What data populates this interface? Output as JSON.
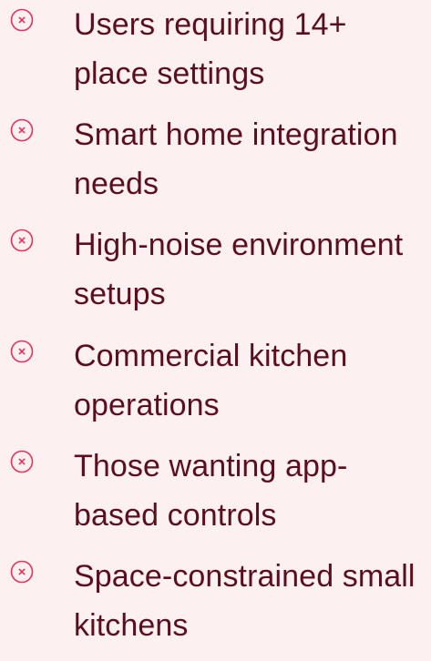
{
  "colors": {
    "background": "#fdf0f1",
    "text": "#5b0f1e",
    "icon": "#ec2f5b"
  },
  "limitations": {
    "items": [
      {
        "icon": "x-circle-icon",
        "text": "Users requiring 14+ place settings"
      },
      {
        "icon": "x-circle-icon",
        "text": "Smart home integration needs"
      },
      {
        "icon": "x-circle-icon",
        "text": "High-noise environment setups"
      },
      {
        "icon": "x-circle-icon",
        "text": "Commercial kitchen operations"
      },
      {
        "icon": "x-circle-icon",
        "text": "Those wanting app-based controls"
      },
      {
        "icon": "x-circle-icon",
        "text": "Space-constrained small kitchens"
      }
    ]
  }
}
